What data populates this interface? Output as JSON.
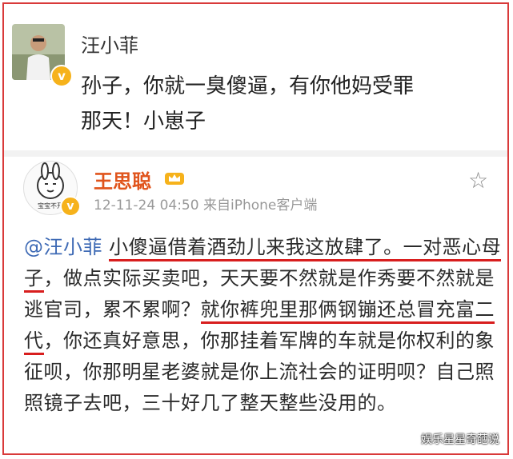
{
  "post1": {
    "author": "汪小菲",
    "verified_badge": "v",
    "text_line1": "孙子，你就一臭傻逼，有你他妈受罪",
    "text_line2": "那天！小崽子"
  },
  "post2": {
    "author": "王思聪",
    "avatar_caption": "宝宝不开",
    "verified_badge": "v",
    "timestamp": "12-11-24 04:50",
    "source": "来自iPhone客户端",
    "body": {
      "mention": "@汪小菲",
      "seg1_u": "小傻逼借着酒劲儿来我这放肆了。一",
      "seg2_u": "对恶心母子",
      "seg3": "，做点实际买卖吧，天天要不然就是作秀要不然就是逃官司，累不累啊？",
      "seg4_u": "就你裤兜里那俩钢镚还总冒充富二代",
      "seg5": "，你还真好意思，你那挂着军牌的车就是你权利的象征呗，你那明星老婆就是你上流社会的证明呗？自己照照镜子去吧，三十好几了整天整些没用的。"
    }
  },
  "watermark": "娱乐星星奇葩说",
  "colors": {
    "border": "#d93a3a",
    "underline": "#d81e1e",
    "mention": "#3e6ab5",
    "name2": "#e0541c"
  }
}
